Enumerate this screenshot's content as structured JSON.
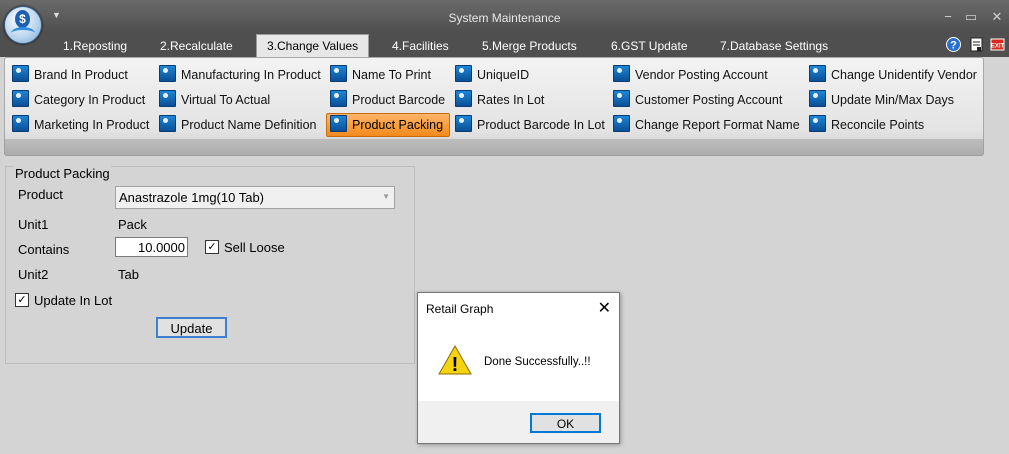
{
  "window": {
    "title": "System Maintenance",
    "logo_text": "$",
    "controls": {
      "minimize": "−",
      "maximize": "▭",
      "close": "✕"
    }
  },
  "tabs": [
    {
      "label": "1.Reposting"
    },
    {
      "label": "2.Recalculate"
    },
    {
      "label": "3.Change Values",
      "active": true
    },
    {
      "label": "4.Facilities"
    },
    {
      "label": "5.Merge Products"
    },
    {
      "label": "6.GST Update"
    },
    {
      "label": "7.Database Settings"
    }
  ],
  "ribbon": {
    "col1": [
      "Brand In Product",
      "Category In Product",
      "Marketing In Product"
    ],
    "col2": [
      "Manufacturing In Product",
      "Virtual To Actual",
      "Product Name Definition"
    ],
    "col3": [
      "Name To Print",
      "Product Barcode",
      "Product Packing"
    ],
    "col4": [
      "UniqueID",
      "Rates In Lot",
      "Product Barcode In Lot"
    ],
    "col5": [
      "Vendor Posting Account",
      "Customer Posting Account",
      "Change Report Format Name"
    ],
    "col6": [
      "Change Unidentify Vendor",
      "Update Min/Max Days",
      "Reconcile Points"
    ],
    "selected": "Product Packing"
  },
  "form": {
    "group_title": "Product Packing",
    "product_label": "Product",
    "product_value": "Anastrazole 1mg(10 Tab)",
    "unit1_label": "Unit1",
    "unit1_value": "Pack",
    "contains_label": "Contains",
    "contains_value": "10.0000",
    "sell_loose_label": "Sell Loose",
    "sell_loose_checked": true,
    "unit2_label": "Unit2",
    "unit2_value": "Tab",
    "update_in_lot_label": "Update In Lot",
    "update_in_lot_checked": true,
    "update_button": "Update",
    "check_mark": "✓"
  },
  "dialog": {
    "title": "Retail Graph",
    "close": "✕",
    "message": "Done Successfully..!!",
    "warning_glyph": "!",
    "ok_button": "OK"
  }
}
